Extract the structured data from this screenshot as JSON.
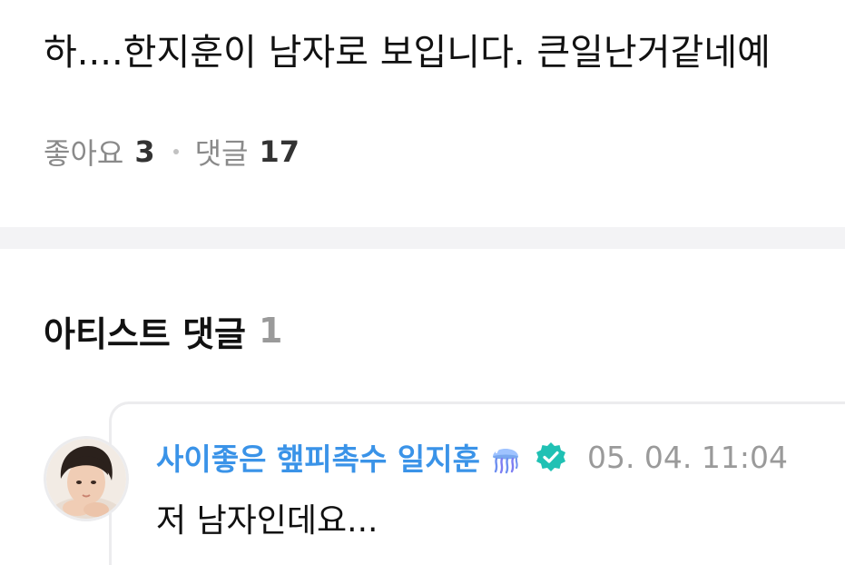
{
  "post": {
    "text": "하....한지훈이 남자로 보입니다. 큰일난거같네예",
    "likes_label": "좋아요",
    "likes_count": "3",
    "comments_label": "댓글",
    "comments_count": "17"
  },
  "artist_comments": {
    "title": "아티스트 댓글",
    "count": "1"
  },
  "comment": {
    "author": "사이좋은 햎피촉수 일지훈",
    "timestamp": "05. 04. 11:04",
    "text": "저 남자인데요...",
    "author_color": "#3a93e8",
    "verified_color": "#20c1b4",
    "icons": [
      "jellyfish-icon",
      "verified-badge-icon"
    ]
  }
}
